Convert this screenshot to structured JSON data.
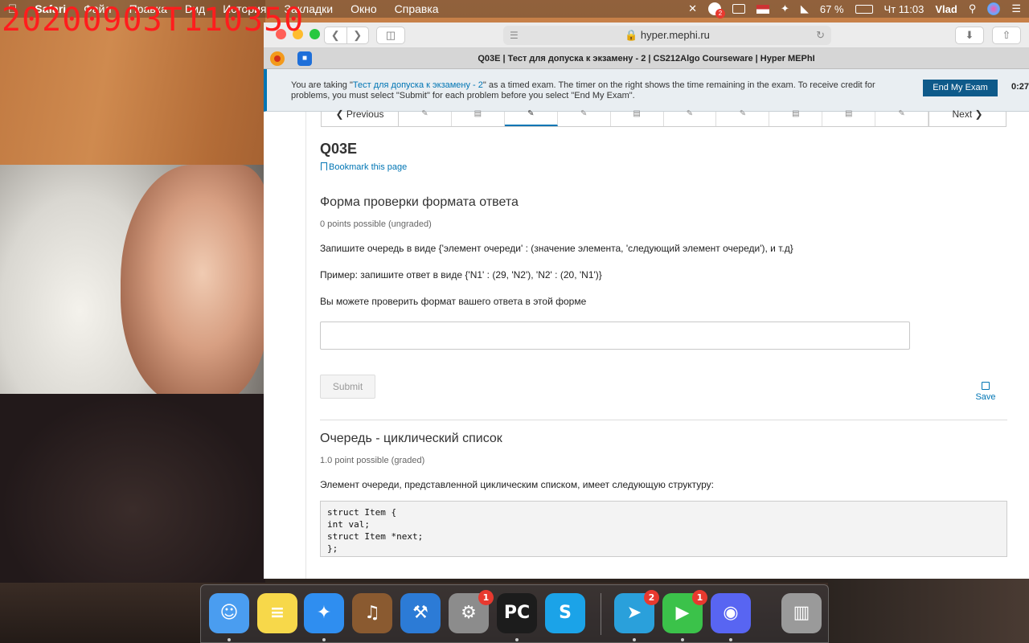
{
  "overlay": {
    "timestamp": "20200903T110350"
  },
  "menubar": {
    "app": "Safari",
    "items": [
      "Файл",
      "Правка",
      "Вид",
      "История",
      "Закладки",
      "Окно",
      "Справка"
    ],
    "battery": "67 %",
    "clock": "Чт 11:03",
    "user": "Vlad",
    "notification_badge": "2"
  },
  "browser": {
    "url": "hyper.mephi.ru",
    "tab_title": "Q03E | Тест для допуска к экзамену - 2 | CS212Algo Courseware | Hyper MEPhI"
  },
  "banner": {
    "msg_prefix": "You are taking \"",
    "exam_link": "Тест для допуска к экзамену - 2",
    "msg_suffix": "\" as a timed exam. The timer on the right shows the time remaining in the exam. To receive credit for problems, you must select \"Submit\" for each problem before you select \"End My Exam\".",
    "end_button": "End My Exam",
    "timer": "0:27:"
  },
  "sequence": {
    "previous": "Previous",
    "next": "Next",
    "item_count": 10,
    "active_index": 2
  },
  "unit": {
    "title": "Q03E",
    "bookmark": "Bookmark this page"
  },
  "problem1": {
    "title": "Форма проверки формата ответа",
    "points": "0 points possible (ungraded)",
    "line1": "Запишите очередь в виде {'элемент очереди' : (значение элемента, 'следующий элемент очереди'), и т.д}",
    "line2": "Пример: запишите ответ в виде {'N1' : (29, 'N2'), 'N2' : (20, 'N1')}",
    "line3": "Вы можете проверить формат вашего ответа в этой форме",
    "input_value": "",
    "submit": "Submit",
    "save": "Save"
  },
  "problem2": {
    "title": "Очередь - циклический список",
    "points": "1.0 point possible (graded)",
    "text": "Элемент очереди, представленной циклическим списком, имеет следующую структуру:",
    "code": "struct Item {\nint val;\nstruct Item *next;\n};"
  },
  "dock": {
    "apps": [
      {
        "name": "Finder",
        "icon": "finder-icon",
        "color": "#4a9df0",
        "running": true
      },
      {
        "name": "Notes",
        "icon": "notes-icon",
        "color": "#f7d84a",
        "running": false
      },
      {
        "name": "Safari",
        "icon": "safari-icon",
        "color": "#2f8ef0",
        "running": true
      },
      {
        "name": "GarageBand",
        "icon": "garageband-icon",
        "color": "#8a5a30",
        "running": false
      },
      {
        "name": "Xcode",
        "icon": "xcode-icon",
        "color": "#2c7bd6",
        "running": false
      },
      {
        "name": "System Preferences",
        "icon": "gear-icon",
        "color": "#8c8c8c",
        "running": false,
        "badge": "1"
      },
      {
        "name": "PyCharm",
        "icon": "pycharm-icon",
        "color": "#1c1c1c",
        "running": true
      },
      {
        "name": "Skype",
        "icon": "skype-icon",
        "color": "#1ba3e8",
        "running": false
      },
      {
        "name": "Telegram",
        "icon": "telegram-icon",
        "color": "#2aa0db",
        "running": true,
        "badge": "2"
      },
      {
        "name": "FaceTime",
        "icon": "facetime-icon",
        "color": "#3bc24a",
        "running": true,
        "badge": "1"
      },
      {
        "name": "Discord",
        "icon": "discord-icon",
        "color": "#5865f2",
        "running": true
      },
      {
        "name": "Trash",
        "icon": "trash-icon",
        "color": "#9a9a9a",
        "running": false
      }
    ]
  }
}
